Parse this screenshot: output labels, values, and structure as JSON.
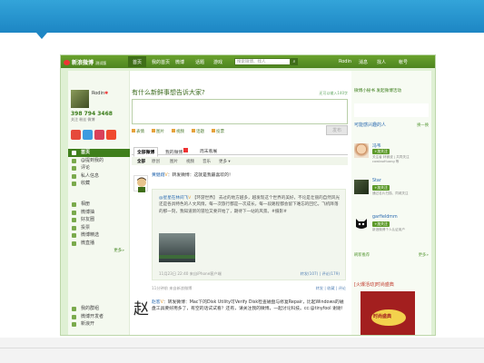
{
  "nav": {
    "logo": "新浪微博",
    "logo_sub": "测试版",
    "items": [
      "首页",
      "我的首页",
      "微博",
      "话题",
      "游戏"
    ],
    "search_placeholder": "搜索微博、找人",
    "user": "Rodin",
    "right_items": [
      "消息",
      "找人",
      "帐号"
    ],
    "accent": "#5a9426"
  },
  "left": {
    "username": "Rodin",
    "stats_line": "398  794  3468",
    "stats_labels": "关注  粉丝  微博",
    "menu": [
      {
        "label": "首页",
        "active": true
      },
      {
        "label": "@提到我的",
        "active": false
      },
      {
        "label": "评论",
        "active": false
      },
      {
        "label": "私人信息",
        "active": false
      },
      {
        "label": "收藏",
        "active": false
      }
    ],
    "menu2": [
      "相册",
      "微博抽",
      "好友圈",
      "投票",
      "微博精选",
      "微直播"
    ],
    "more": "更多»",
    "menu3": [
      "我的群组",
      "微博开发者",
      "新浪开"
    ]
  },
  "main": {
    "prompt": "有什么新鲜事想告诉大家?",
    "prompt_right": "还可以输入140字",
    "tools": [
      "表情",
      "图片",
      "视频",
      "话题",
      "投票"
    ],
    "post_button": "发布",
    "tabs": [
      "全部微博",
      "我的微博",
      "周末看展"
    ],
    "filters": [
      "全部",
      "原创",
      "图片",
      "视频",
      "音乐",
      "更多 ▾"
    ],
    "post1": {
      "author": "黄健翔",
      "text": "：转发微博：这就是我最喜欢的！"
    },
    "repost": {
      "author": "@星星在林间飞",
      "text": "【环游世界】 去过的地方越多，越发现这个世界的美好，不论是壮丽的自然风光还是各具特色的人文风情，每一次旅行都是一次成长，每一段路程都会留下难忘的回忆。飞机降落的那一刻，我知道新的冒险又要开始了，期待下一站的风景。#摄影#"
    },
    "repost_meta": "11月23日 22:40  来自iPhone客户端",
    "repost_actions": "转发(107) | 评论(179)",
    "post1_meta": "11分钟前  来自新浪微博",
    "post1_actions": "转发 | 收藏 | 评论",
    "post2": {
      "author": "赵客",
      "text": "：转发微博：Mac下的Disk Utility可Verify Disk检查磁盘与修复Repair，比起Windows的磁盘工具要好用多了，有空的话试试看？还有，请关注我的微博，一起讨论科技。cc:@tinyfool 谢谢！"
    }
  },
  "right": {
    "top": "微博小秘书  发起微博活动",
    "title": "可能感兴趣的人",
    "more": "换一换",
    "suggestions": [
      {
        "name": "冯韦",
        "btn": "+加关注",
        "sub": "关注者 林微波 | 共同关注 cowtaoHuang 等"
      },
      {
        "name": "Star",
        "btn": "+加关注",
        "sub": "通过名片扫描、同城关注"
      },
      {
        "name": "garfieldmm",
        "btn": "+加关注",
        "sub": "新浪微博个人认证用户"
      }
    ],
    "change_left": "刷新推荐",
    "change_right": "更多»",
    "ad_title": "[火爆活动]时尚盛典",
    "ad_text": "时尚盛典"
  }
}
